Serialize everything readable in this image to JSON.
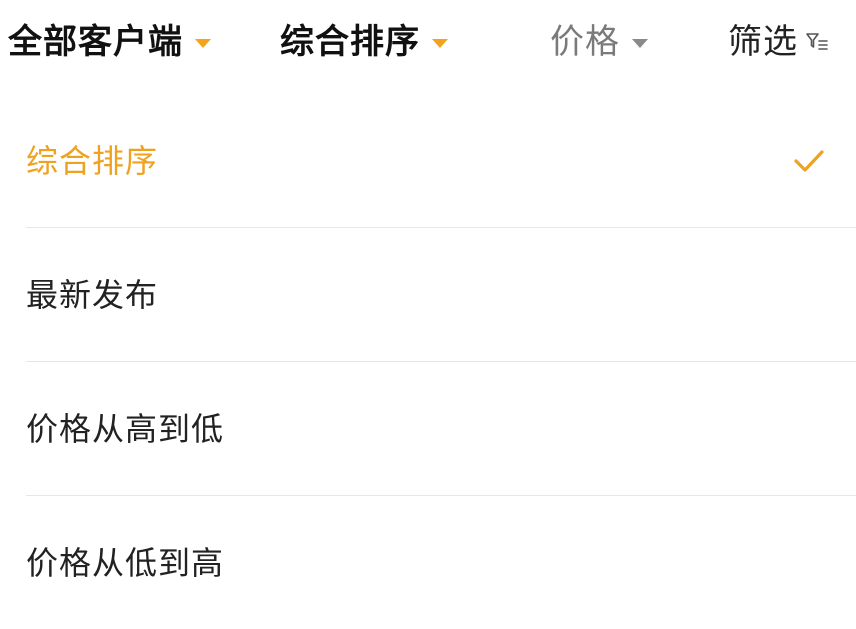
{
  "tabs": [
    {
      "label": "全部客户端",
      "caret_color": "#f2a51a",
      "icon": "chevron-down-icon"
    },
    {
      "label": "综合排序",
      "caret_color": "#f2a51a",
      "icon": "chevron-down-icon"
    },
    {
      "label": "价格",
      "caret_color": "#8a8a8a",
      "icon": "chevron-down-icon"
    },
    {
      "label": "筛选",
      "icon": "filter-icon"
    }
  ],
  "sort_options": [
    {
      "label": "综合排序",
      "selected": true
    },
    {
      "label": "最新发布",
      "selected": false
    },
    {
      "label": "价格从高到低",
      "selected": false
    },
    {
      "label": "价格从低到高",
      "selected": false
    }
  ],
  "colors": {
    "accent": "#eea21f",
    "divider": "#e7e7e7",
    "muted": "#7a7a7a",
    "text": "#222222"
  },
  "icons": {
    "selected_mark": "checkmark-icon"
  }
}
